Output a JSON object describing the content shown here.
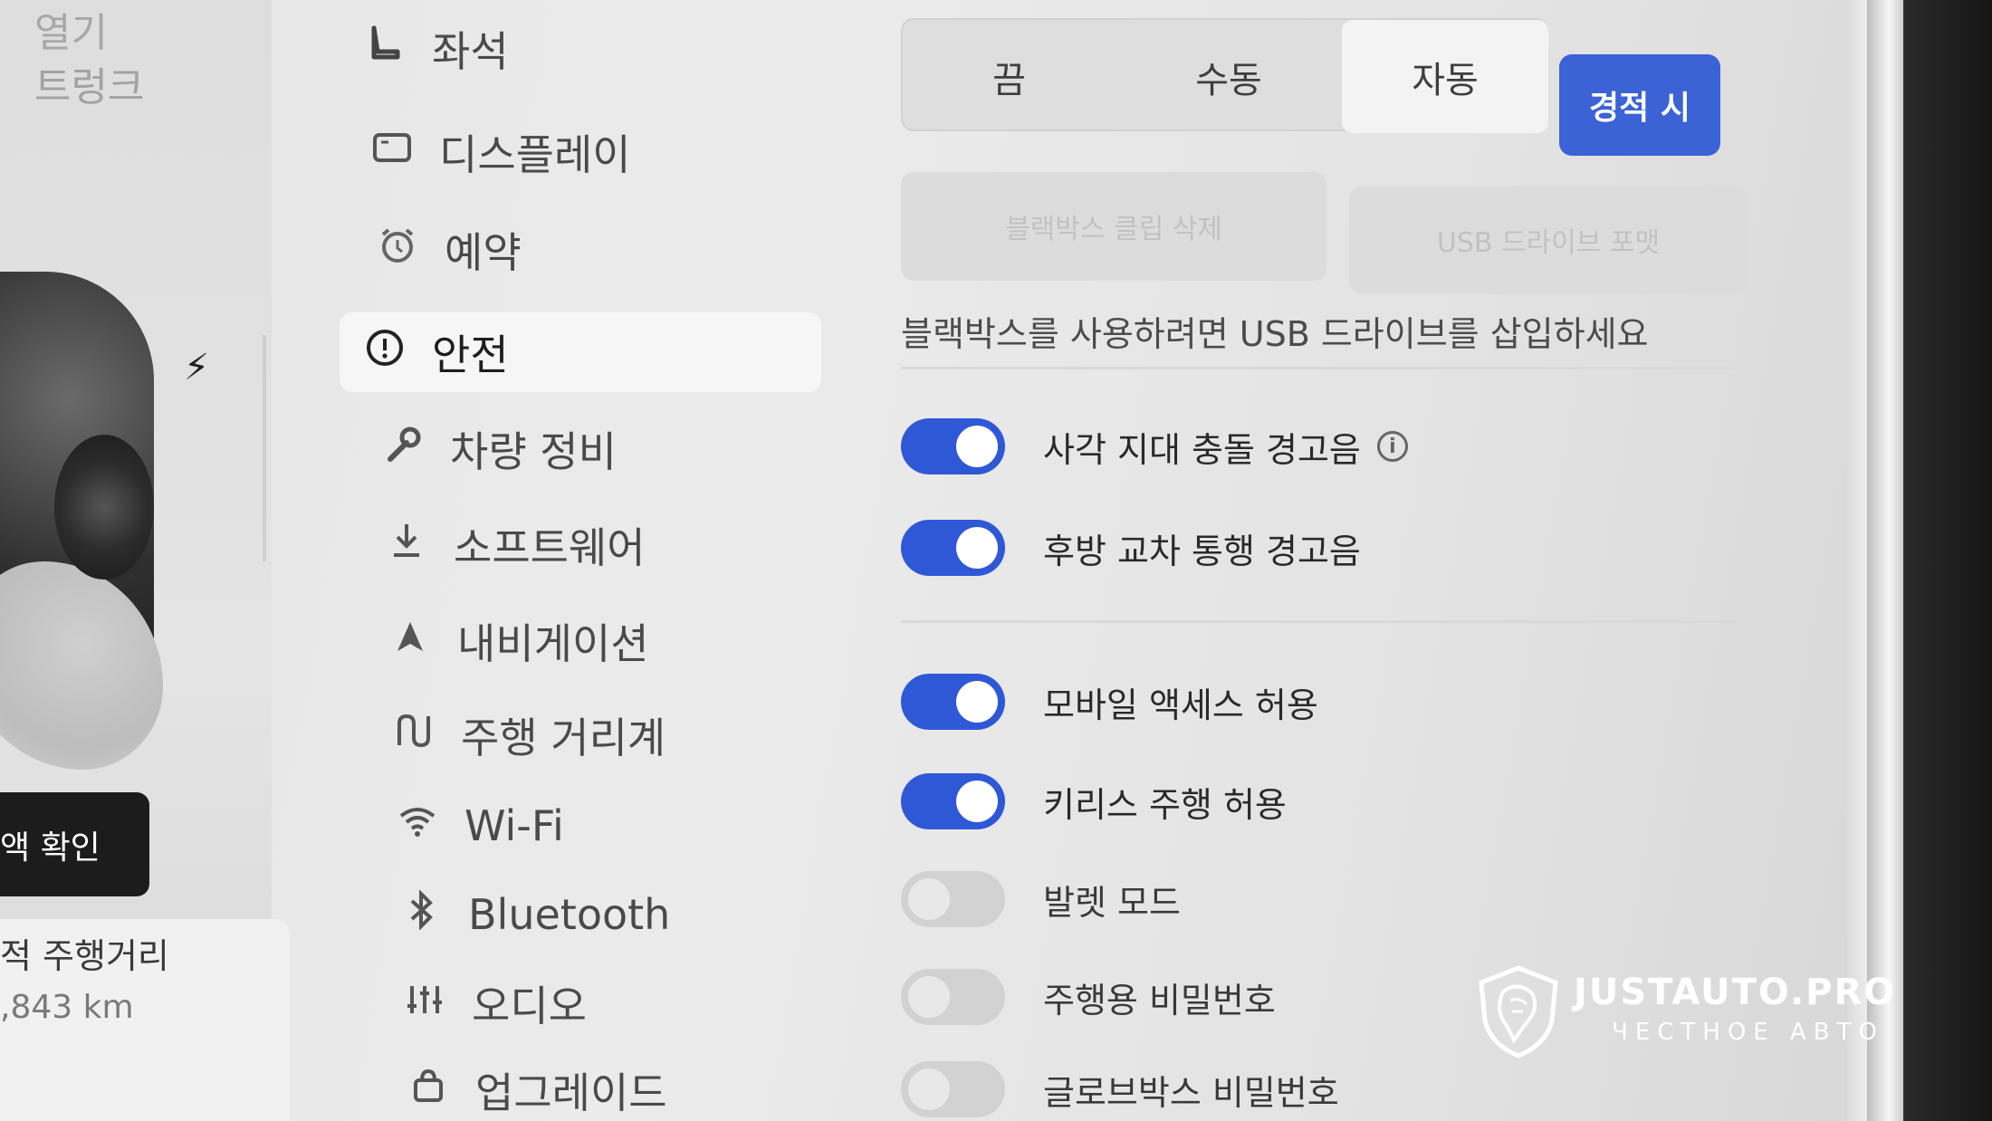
{
  "car_panel": {
    "open_label": "열기",
    "trunk_label": "트렁크",
    "check_button": "액 확인",
    "odometer_title": "적 주행거리",
    "odometer_value": ",843 km"
  },
  "menu": {
    "items": [
      {
        "label": "좌석",
        "icon": "seat-icon"
      },
      {
        "label": "디스플레이",
        "icon": "display-icon"
      },
      {
        "label": "예약",
        "icon": "alarm-clock-icon"
      },
      {
        "label": "안전",
        "icon": "alert-circle-icon",
        "active": true
      },
      {
        "label": "차량 정비",
        "icon": "wrench-icon"
      },
      {
        "label": "소프트웨어",
        "icon": "download-icon"
      },
      {
        "label": "내비게이션",
        "icon": "navigation-arrow-icon"
      },
      {
        "label": "주행 거리계",
        "icon": "trip-icon"
      },
      {
        "label": "Wi-Fi",
        "icon": "wifi-icon"
      },
      {
        "label": "Bluetooth",
        "icon": "bluetooth-icon"
      },
      {
        "label": "오디오",
        "icon": "equalizer-icon"
      },
      {
        "label": "업그레이드",
        "icon": "shopping-bag-icon"
      }
    ]
  },
  "dashcam": {
    "modes": [
      "끔",
      "수동",
      "자동"
    ],
    "selected_mode": "자동",
    "sentry_label": "경적 시",
    "delete_clips_label": "블랙박스 클립 삭제",
    "format_usb_label": "USB 드라이브 포맷",
    "usb_note": "블랙박스를 사용하려면 USB 드라이브를 삽입하세요"
  },
  "toggles": [
    {
      "label": "사각 지대 충돌 경고음",
      "on": true,
      "info": true
    },
    {
      "label": "후방 교차 통행 경고음",
      "on": true
    },
    {
      "label": "모바일 액세스 허용",
      "on": true
    },
    {
      "label": "키리스 주행 허용",
      "on": true
    },
    {
      "label": "발렛 모드",
      "on": false
    },
    {
      "label": "주행용 비밀번호",
      "on": false
    },
    {
      "label": "글로브박스 비밀번호",
      "on": false
    }
  ],
  "colors": {
    "accent": "#2f58d6",
    "sentry_button": "#3b63d6"
  },
  "watermark": {
    "brand": "JUSTAUTO.PRO",
    "tagline": "ЧЕСТНОЕ АВТО"
  }
}
